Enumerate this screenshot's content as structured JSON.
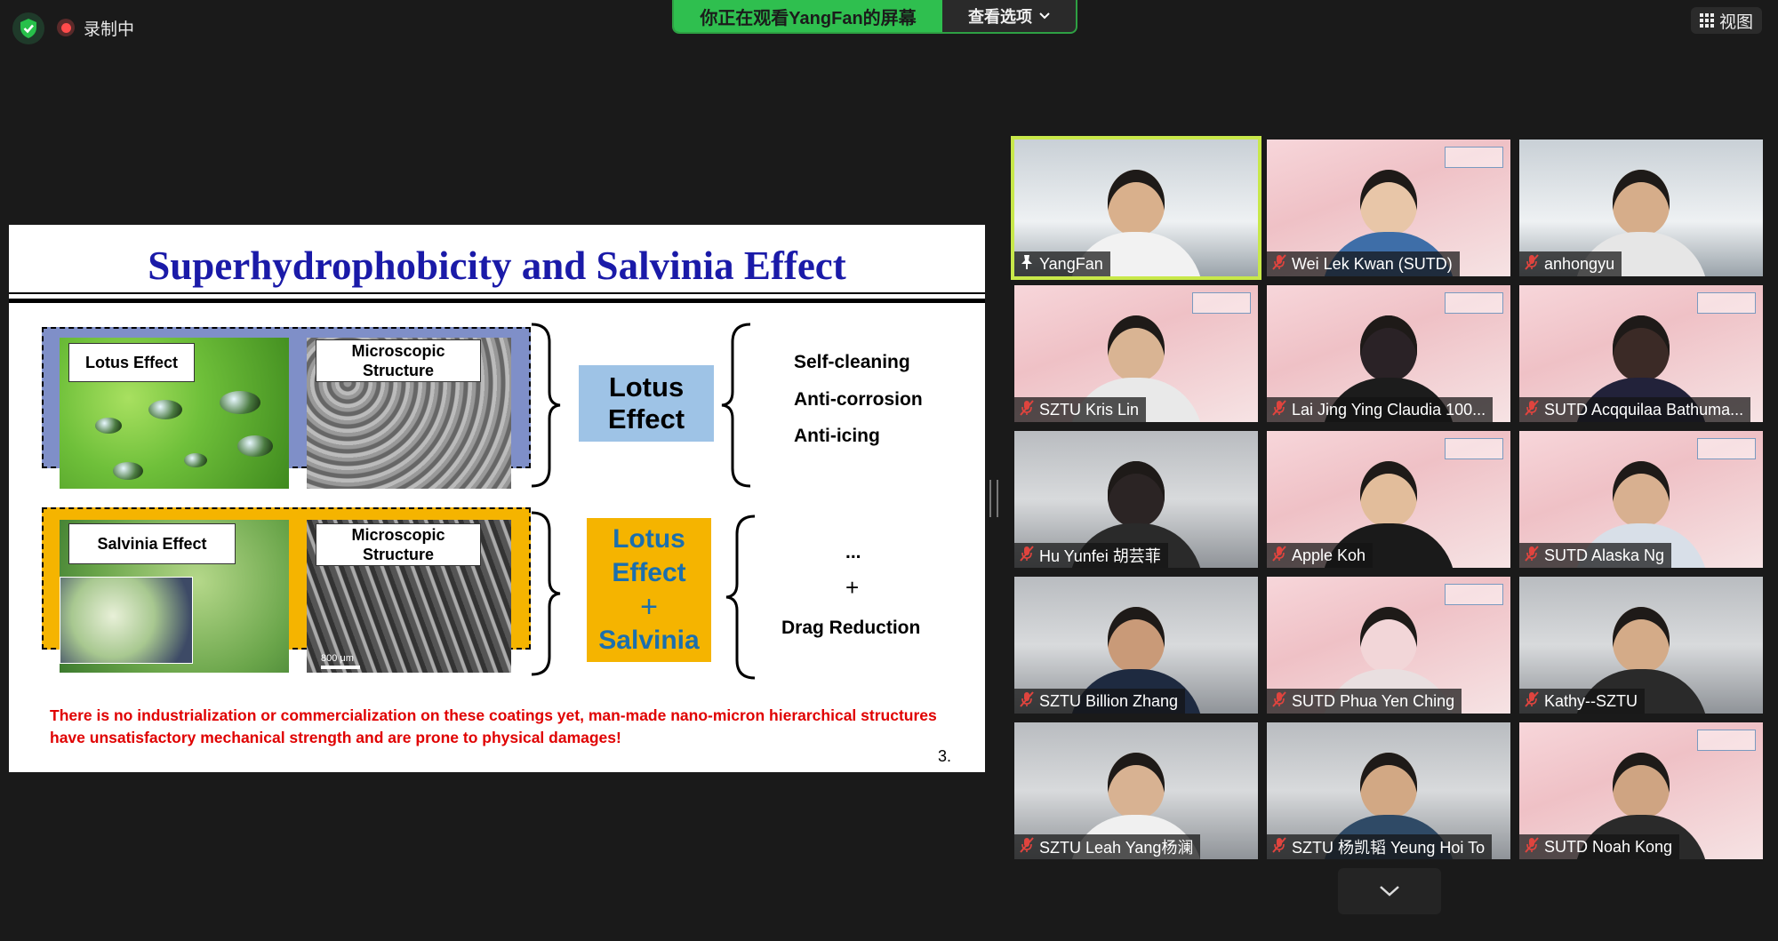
{
  "topbar": {
    "recording_label": "录制中",
    "share_notice": "你正在观看YangFan的屏幕",
    "view_options": "查看选项",
    "view_button": "视图"
  },
  "slide": {
    "title": "Superhydrophobicity and Salvinia Effect",
    "row1": {
      "photo_label": "Lotus Effect",
      "micro_label": "Microscopic Structure",
      "effect": "Lotus Effect",
      "outcomes": [
        "Self-cleaning",
        "Anti-corrosion",
        "Anti-icing"
      ]
    },
    "row2": {
      "photo_label": "Salvinia Effect",
      "micro_label": "Microscopic Structure",
      "scale": "800 μm",
      "effect_line1": "Lotus Effect",
      "effect_plus": "+",
      "effect_line2": "Salvinia",
      "outcomes": [
        "...",
        "+",
        "Drag Reduction"
      ]
    },
    "note": "There is no industrialization or commercialization on these coatings yet, man-made nano-micron hierarchical structures have unsatisfactory mechanical strength and are prone to physical damages!",
    "page_number": "3."
  },
  "participants": [
    {
      "name": "YangFan",
      "icon": "pin-icon",
      "active": true
    },
    {
      "name": "Wei Lek Kwan (SUTD)",
      "icon": "mic-off-icon"
    },
    {
      "name": "anhongyu",
      "icon": "mic-off-icon"
    },
    {
      "name": "SZTU Kris Lin",
      "icon": "mic-off-icon"
    },
    {
      "name": "Lai Jing Ying Claudia 100...",
      "icon": "mic-off-icon"
    },
    {
      "name": "SUTD Acqquilaa Bathuma...",
      "icon": "mic-off-icon"
    },
    {
      "name": "Hu Yunfei 胡芸菲",
      "icon": "mic-off-icon"
    },
    {
      "name": "Apple Koh",
      "icon": "mic-off-icon"
    },
    {
      "name": "SUTD Alaska Ng",
      "icon": "mic-off-icon"
    },
    {
      "name": "SZTU Billion Zhang",
      "icon": "mic-off-icon"
    },
    {
      "name": "SUTD Phua Yen Ching",
      "icon": "mic-off-icon"
    },
    {
      "name": "Kathy--SZTU",
      "icon": "mic-off-icon"
    },
    {
      "name": "SZTU Leah Yang杨澜",
      "icon": "mic-off-icon"
    },
    {
      "name": "SZTU 杨凯韬 Yeung Hoi To",
      "icon": "mic-off-icon"
    },
    {
      "name": "SUTD Noah Kong",
      "icon": "mic-off-icon"
    }
  ],
  "colors": {
    "share_green": "#2fbf4f",
    "active_outline": "#c8e84a",
    "slide_title_blue": "#1a1aa8",
    "note_red": "#e00000",
    "mic_off_red": "#e0443e"
  }
}
